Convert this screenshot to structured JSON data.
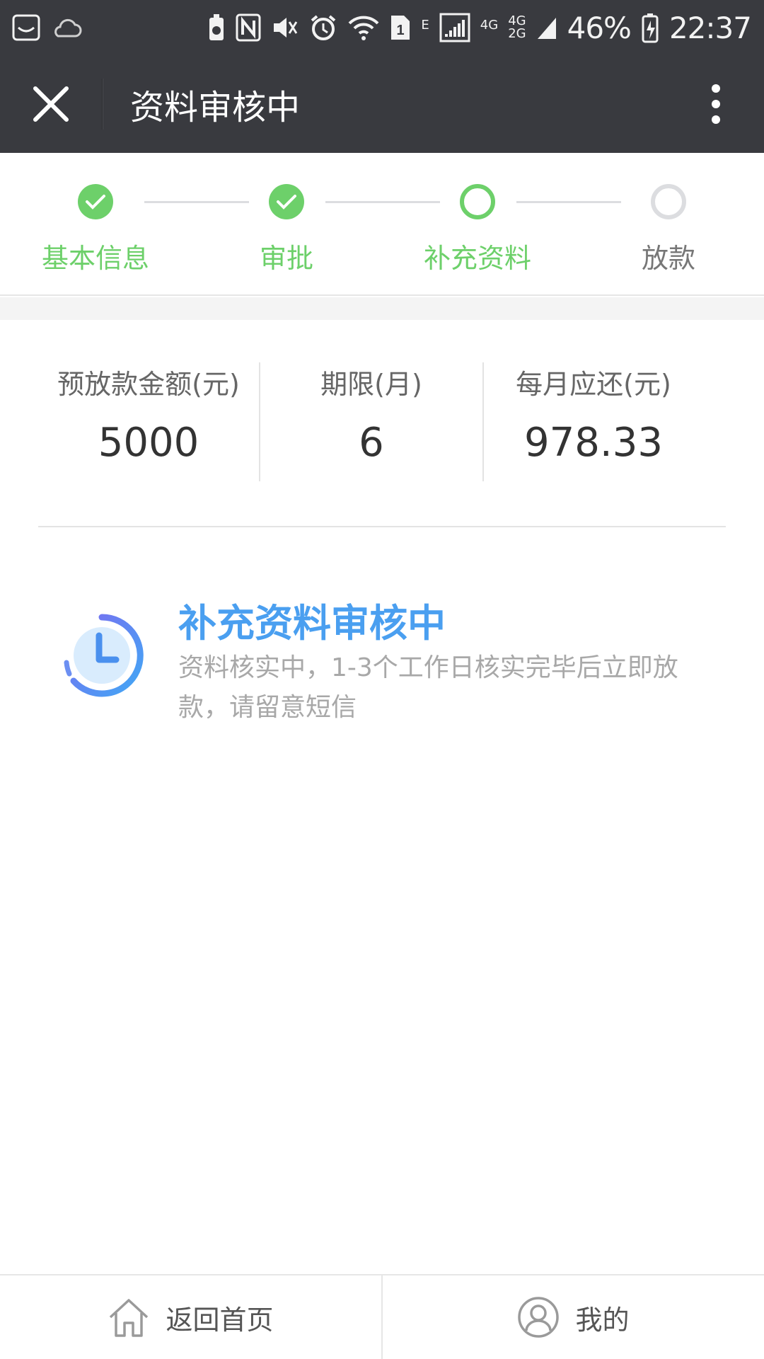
{
  "status_bar": {
    "network_small_top": "4G",
    "network_small_bottom": "2G",
    "network_4g": "4G",
    "network_e": "E",
    "sim_label": "1",
    "battery": "46%",
    "time": "22:37"
  },
  "titlebar": {
    "title": "资料审核中"
  },
  "steps": [
    {
      "label": "基本信息",
      "state": "done"
    },
    {
      "label": "审批",
      "state": "done"
    },
    {
      "label": "补充资料",
      "state": "current"
    },
    {
      "label": "放款",
      "state": "pending"
    }
  ],
  "summary": [
    {
      "label": "预放款金额(元)",
      "value": "5000"
    },
    {
      "label": "期限(月)",
      "value": "6"
    },
    {
      "label": "每月应还(元)",
      "value": "978.33"
    }
  ],
  "status": {
    "title": "补充资料审核中",
    "description": "资料核实中，1-3个工作日核实完毕后立即放款，请留意短信"
  },
  "bottom_nav": {
    "home_label": "返回首页",
    "mine_label": "我的"
  },
  "colors": {
    "header_bg": "#393a3f",
    "accent_green": "#6dd06a",
    "accent_blue": "#4a9ff0"
  }
}
